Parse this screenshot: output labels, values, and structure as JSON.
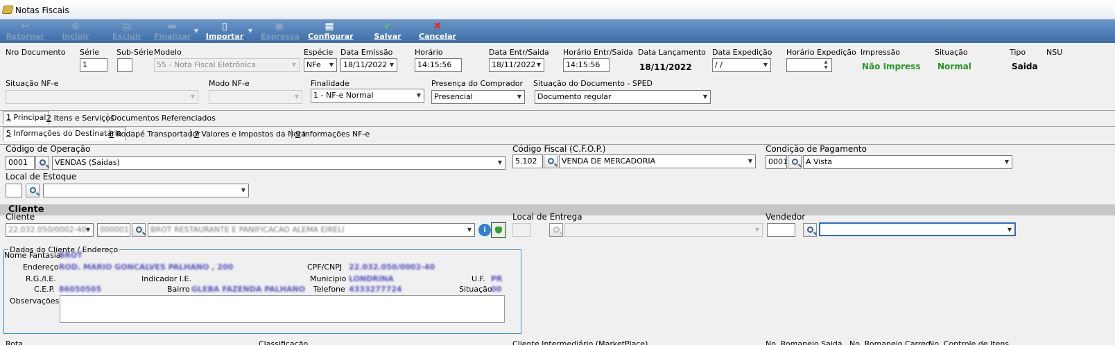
{
  "window": {
    "title": "Notas Fiscais"
  },
  "toolbar": {
    "retornar": "Retornar",
    "incluir": "Incluir",
    "excluir": "Excluir",
    "finalizar": "Finalizar",
    "importar": "Importar",
    "expressa": "Expressa",
    "configurar": "Configurar",
    "salvar": "Salvar",
    "cancelar": "Cancelar"
  },
  "header": {
    "nro_documento": "Nro Documento",
    "serie_label": "Série",
    "serie_value": "1",
    "subserie_label": "Sub-Série",
    "modelo_label": "Modelo",
    "modelo_value": "55 - Nota Fiscal Eletrônica",
    "especie_label": "Espécie",
    "especie_value": "NFe",
    "data_emissao_label": "Data Emissão",
    "data_emissao_value": "18/11/2022",
    "horario_label": "Horário",
    "horario_value": "14:15:56",
    "data_entr_label": "Data Entr/Saida",
    "data_entr_value": "18/11/2022",
    "horario_entr_label": "Horário Entr/Saida",
    "horario_entr_value": "14:15:56",
    "data_lanc_label": "Data Lançamento",
    "data_lanc_value": "18/11/2022",
    "data_exped_label": "Data Expedição",
    "data_exped_value": " / /",
    "horario_exped_label": "Horário Expedição",
    "impressao_label": "Impressão",
    "impressao_value": "Não Impressa",
    "situacao_label": "Situação",
    "situacao_value": "Normal",
    "tipo_label": "Tipo",
    "tipo_value": "Saida",
    "nsu_label": "NSU",
    "situacao_nfe_label": "Situação NF-e",
    "modo_nfe_label": "Modo NF-e",
    "finalidade_label": "Finalidade",
    "finalidade_value": "1 - NF-e Normal",
    "presenca_label": "Presença do Comprador",
    "presenca_value": "Presencial",
    "situacao_sped_label": "Situação do Documento - SPED",
    "situacao_sped_value": "Documento regular"
  },
  "tabs1": [
    {
      "key": "1",
      "rest": " Principal"
    },
    {
      "key": "2",
      "rest": " Itens e Serviços"
    },
    {
      "key": "",
      "rest": "Documentos Referenciados"
    }
  ],
  "tabs2": [
    {
      "key": "5",
      "rest": " Informações do Destinatário"
    },
    {
      "key": "6",
      "rest": " Rodapé Transportador"
    },
    {
      "key": "7",
      "rest": " Valores e Impostos da Nota"
    },
    {
      "key": "9",
      "rest": " Informações NF-e"
    }
  ],
  "main": {
    "cod_operacao_label": "Código de Operação",
    "cod_operacao_code": "0001",
    "cod_operacao_desc": "VENDAS (Saidas)",
    "cfop_label": "Código Fiscal (C.F.O.P.)",
    "cfop_code": "5.102",
    "cfop_desc": "VENDA DE MERCADORIA",
    "cond_pag_label": "Condição de Pagamento",
    "cond_pag_code": "0001",
    "cond_pag_desc": "A Vista",
    "local_estoque_label": "Local de Estoque",
    "cliente_section": "Cliente",
    "cliente_label": "Cliente",
    "cliente_cnpj": "22.032.050/0002-40",
    "cliente_code": "000001",
    "cliente_name": "BROT RESTAURANTE E PANIFICACAO ALEMA EIRELI",
    "local_entrega_label": "Local de Entrega",
    "vendedor_label": "Vendedor"
  },
  "dados": {
    "title": "Dados do Cliente / Endereço",
    "nome_fantasia_label": "Nome Fantasia",
    "nome_fantasia_value": "BROT",
    "endereco_label": "Endereço",
    "endereco_value": "ROD. MARIO GONCALVES PALHANO , 200",
    "cpf_label": "CPF/CNPJ",
    "cpf_value": "22.032.050/0002-40",
    "rg_label": "R.G./I.E.",
    "indicador_label": "Indicador I.E.",
    "municipio_label": "Municipio",
    "municipio_value": "LONDRINA",
    "uf_label": "U.F.",
    "uf_value": "PR",
    "cep_label": "C.E.P.",
    "cep_value": "86050505",
    "bairro_label": "Bairro",
    "bairro_value": "GLEBA FAZENDA PALHANO",
    "telefone_label": "Telefone",
    "telefone_value": "4333277724",
    "situacao_label": "Situação",
    "situacao_value": "00",
    "observacoes_label": "Observações"
  },
  "bottom": {
    "rota": "Rota",
    "classificacao": "Classificação",
    "intermediario": "Cliente Intermediário (MarketPlace)",
    "romaneio": "No. Romaneio Saida",
    "romaneio_carreg": "No. Romaneio Carreg.",
    "controle": "No. Controle de Itens"
  }
}
